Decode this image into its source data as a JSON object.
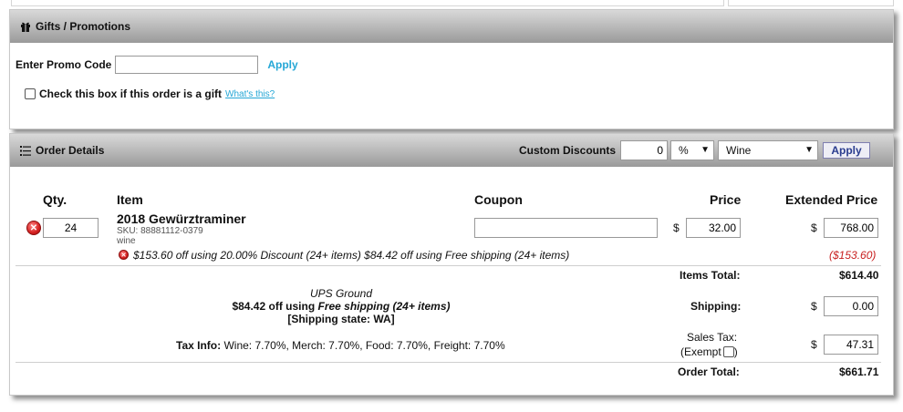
{
  "gifts": {
    "title": "Gifts / Promotions",
    "promo_label": "Enter Promo Code",
    "promo_value": "",
    "apply_label": "Apply",
    "gift_checkbox_label": "Check this box if this order is a gift",
    "whats_this": "What's this?"
  },
  "order": {
    "title": "Order Details",
    "custom_discounts_label": "Custom Discounts",
    "custom_discount_value": "0",
    "discount_unit": "%",
    "discount_category": "Wine",
    "apply_label": "Apply",
    "columns": {
      "qty": "Qty.",
      "item": "Item",
      "coupon": "Coupon",
      "price": "Price",
      "extended_price": "Extended Price"
    },
    "line_item": {
      "qty": "24",
      "name": "2018 Gewürztraminer",
      "sku": "SKU: 88881112-0379",
      "category": "wine",
      "coupon": "",
      "price_currency": "$",
      "price": "32.00",
      "extended_currency": "$",
      "extended": "768.00",
      "discount_note": "$153.60 off using 20.00% Discount (24+ items) $84.42 off using Free shipping (24+ items)",
      "discount_amount": "($153.60)"
    },
    "shipping_info": {
      "method": "UPS Ground",
      "discount_prefix": "$84.42 off using ",
      "discount_name": "Free shipping (24+ items)",
      "state": "[Shipping state: WA]"
    },
    "tax_info_label": "Tax Info:",
    "tax_info": "Wine: 7.70%, Merch: 7.70%, Food: 7.70%, Freight: 7.70%",
    "totals": {
      "items_total_label": "Items Total:",
      "items_total": "$614.40",
      "shipping_label": "Shipping:",
      "shipping_currency": "$",
      "shipping": "0.00",
      "sales_tax_label": "Sales Tax:",
      "exempt_open": "(Exempt",
      "exempt_close": ")",
      "tax_currency": "$",
      "sales_tax": "47.31",
      "order_total_label": "Order Total:",
      "order_total": "$661.71"
    }
  },
  "colors": {
    "link": "#25a7d6",
    "remove_red": "#d42020",
    "discount_red": "#c81e1e"
  }
}
